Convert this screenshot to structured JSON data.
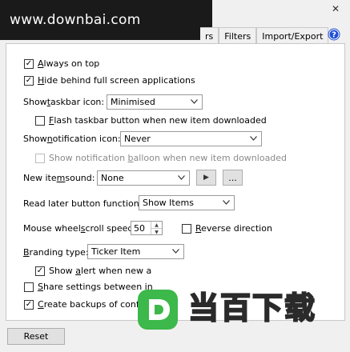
{
  "watermark": {
    "site": "www.downbai.com",
    "brand_text": "当百下载"
  },
  "window": {
    "close_glyph": "✕"
  },
  "tabs": [
    {
      "label": "rs"
    },
    {
      "label": "Filters"
    },
    {
      "label": "Import/Export"
    }
  ],
  "options": {
    "always_on_top": {
      "label_pre": "",
      "label_u": "A",
      "label_post": "lways on top",
      "checked": true
    },
    "hide_fullscreen": {
      "label_pre": "",
      "label_u": "H",
      "label_post": "ide behind full screen applications",
      "checked": true
    },
    "taskbar_icon": {
      "label_pre": "Show ",
      "label_u": "t",
      "label_post": "askbar icon:",
      "value": "Minimised"
    },
    "flash_taskbar": {
      "label_pre": "",
      "label_u": "F",
      "label_post": "lash taskbar button when new item downloaded",
      "checked": false
    },
    "notification_icon": {
      "label_pre": "Show ",
      "label_u": "n",
      "label_post": "otification icon:",
      "value": "Never"
    },
    "notification_balloon": {
      "label_pre": "Show notification ",
      "label_u": "b",
      "label_post": "alloon when new item downloaded",
      "checked": false
    },
    "new_item_sound": {
      "label_pre": "New ite",
      "label_u": "m",
      "label_post": " sound:",
      "value": "None",
      "play_glyph": "▶",
      "browse_label": "..."
    },
    "read_later": {
      "label": "Read later button function:",
      "value": "Show Items"
    },
    "mouse_wheel": {
      "label_pre": "Mouse wheel ",
      "label_u": "s",
      "label_post": "croll speed:",
      "value": "50"
    },
    "reverse_direction": {
      "label_pre": "",
      "label_u": "R",
      "label_post": "everse direction",
      "checked": false
    },
    "branding": {
      "label_pre": "",
      "label_u": "B",
      "label_post": "randing type:",
      "value": "Ticker Item"
    },
    "show_alert": {
      "label_pre": "Show ",
      "label_u": "a",
      "label_post": "lert when new a",
      "checked": true
    },
    "share_settings": {
      "label_pre": "",
      "label_u": "S",
      "label_post": "hare settings between in",
      "checked": false
    },
    "create_backups": {
      "label_pre": "",
      "label_u": "C",
      "label_post": "reate backups of configu",
      "checked": true
    }
  },
  "footer": {
    "reset_label": "Reset"
  },
  "colors": {
    "accent": "#1e4fd6",
    "logo_green": "#3db84a",
    "logo_white": "#ffffff"
  },
  "icons": {
    "help": "help-icon",
    "dropdown": "chevron-down-icon",
    "check": "check-icon"
  }
}
